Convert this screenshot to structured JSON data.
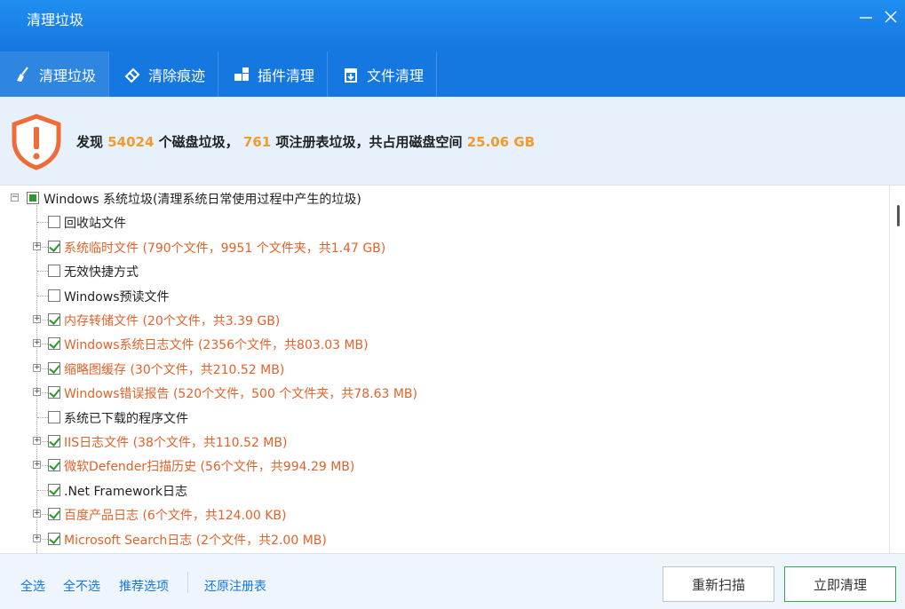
{
  "window": {
    "title": "清理垃圾"
  },
  "tabs": [
    {
      "label": "清理垃圾",
      "icon": "broom-icon"
    },
    {
      "label": "清除痕迹",
      "icon": "eraser-icon"
    },
    {
      "label": "插件清理",
      "icon": "plugin-icon"
    },
    {
      "label": "文件清理",
      "icon": "file-trash-icon"
    }
  ],
  "summary": {
    "prefix": "发现",
    "disk_count": "54024",
    "mid1": "个磁盘垃圾，",
    "reg_count": "761",
    "mid2": "项注册表垃圾，共占用磁盘空间",
    "size": "25.06 GB"
  },
  "tree": {
    "root": {
      "label": "Windows 系统垃圾(清理系统日常使用过程中产生的垃圾)"
    },
    "items": [
      {
        "label": "回收站文件",
        "checked": false,
        "expandable": false,
        "highlight": false
      },
      {
        "label": "系统临时文件 (790个文件，9951 个文件夹，共1.47 GB)",
        "checked": true,
        "expandable": true,
        "highlight": true
      },
      {
        "label": "无效快捷方式",
        "checked": false,
        "expandable": false,
        "highlight": false
      },
      {
        "label": "Windows预读文件",
        "checked": false,
        "expandable": false,
        "highlight": false
      },
      {
        "label": "内存转储文件 (20个文件，共3.39 GB)",
        "checked": true,
        "expandable": true,
        "highlight": true
      },
      {
        "label": "Windows系统日志文件 (2356个文件，共803.03 MB)",
        "checked": true,
        "expandable": true,
        "highlight": true
      },
      {
        "label": "缩略图缓存 (30个文件，共210.52 MB)",
        "checked": true,
        "expandable": true,
        "highlight": true
      },
      {
        "label": "Windows错误报告 (520个文件，500 个文件夹，共78.63 MB)",
        "checked": true,
        "expandable": true,
        "highlight": true
      },
      {
        "label": "系统已下载的程序文件",
        "checked": false,
        "expandable": false,
        "highlight": false
      },
      {
        "label": "IIS日志文件 (38个文件，共110.52 MB)",
        "checked": true,
        "expandable": true,
        "highlight": true
      },
      {
        "label": "微软Defender扫描历史 (56个文件，共994.29 MB)",
        "checked": true,
        "expandable": true,
        "highlight": true
      },
      {
        "label": ".Net Framework日志",
        "checked": true,
        "expandable": false,
        "highlight": false
      },
      {
        "label": "百度产品日志 (6个文件，共124.00 KB)",
        "checked": true,
        "expandable": true,
        "highlight": true
      },
      {
        "label": "Microsoft Search日志 (2个文件，共2.00 MB)",
        "checked": true,
        "expandable": true,
        "highlight": true
      }
    ]
  },
  "footer": {
    "select_all": "全选",
    "select_none": "全不选",
    "recommended": "推荐选项",
    "restore_registry": "还原注册表",
    "rescan": "重新扫描",
    "clean_now": "立即清理"
  },
  "colors": {
    "accent": "#1577e0",
    "highlight": "#e2622a",
    "count": "#f39a2b",
    "check": "#2a9a2a"
  }
}
